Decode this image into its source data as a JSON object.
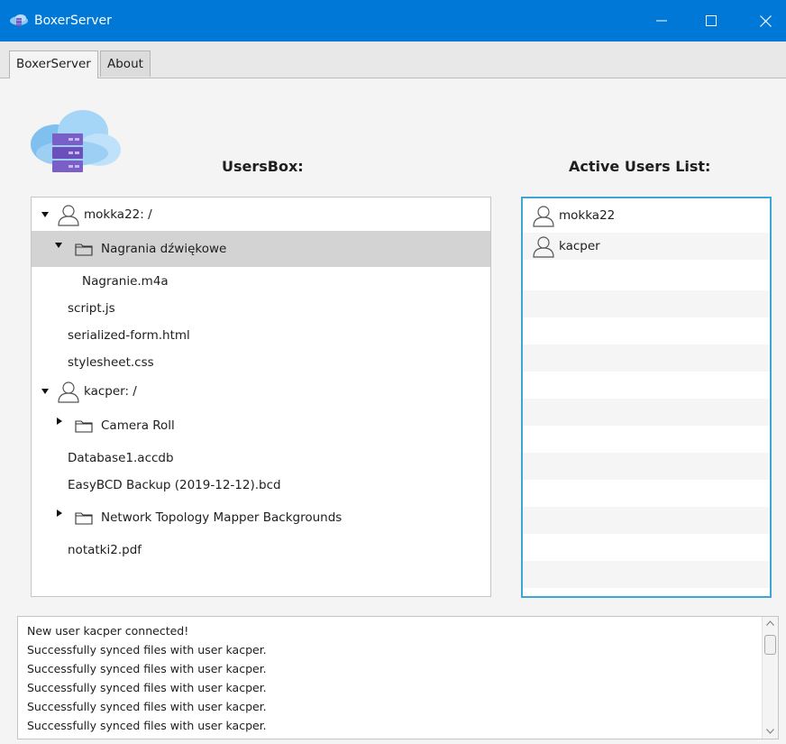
{
  "window": {
    "title": "BoxerServer",
    "accent": "#0078d7"
  },
  "tabs": [
    {
      "label": "BoxerServer",
      "active": true
    },
    {
      "label": "About",
      "active": false
    }
  ],
  "headings": {
    "users_box": "UsersBox:",
    "active_users": "Active Users List:"
  },
  "tree": [
    {
      "label": "mokka22: /",
      "icon": "user-icon",
      "expanded": true
    },
    {
      "label": "Nagrania dźwiękowe",
      "icon": "folder-icon",
      "expanded": true,
      "selected": true
    },
    {
      "label": "Nagranie.m4a"
    },
    {
      "label": "script.js"
    },
    {
      "label": "serialized-form.html"
    },
    {
      "label": "stylesheet.css"
    },
    {
      "label": "kacper: /",
      "icon": "user-icon",
      "expanded": true
    },
    {
      "label": "Camera Roll",
      "icon": "folder-icon",
      "expanded": false
    },
    {
      "label": "Database1.accdb"
    },
    {
      "label": "EasyBCD Backup (2019-12-12).bcd"
    },
    {
      "label": "Network Topology Mapper Backgrounds",
      "icon": "folder-icon",
      "expanded": false
    },
    {
      "label": "notatki2.pdf"
    }
  ],
  "active_users": [
    {
      "label": "mokka22",
      "icon": "user-icon"
    },
    {
      "label": "kacper",
      "icon": "user-icon"
    }
  ],
  "log": [
    "New user kacper connected!",
    "Successfully synced files with user kacper.",
    "Successfully synced files with user kacper.",
    "Successfully synced files with user kacper.",
    "Successfully synced files with user kacper.",
    "Successfully synced files with user kacper."
  ]
}
